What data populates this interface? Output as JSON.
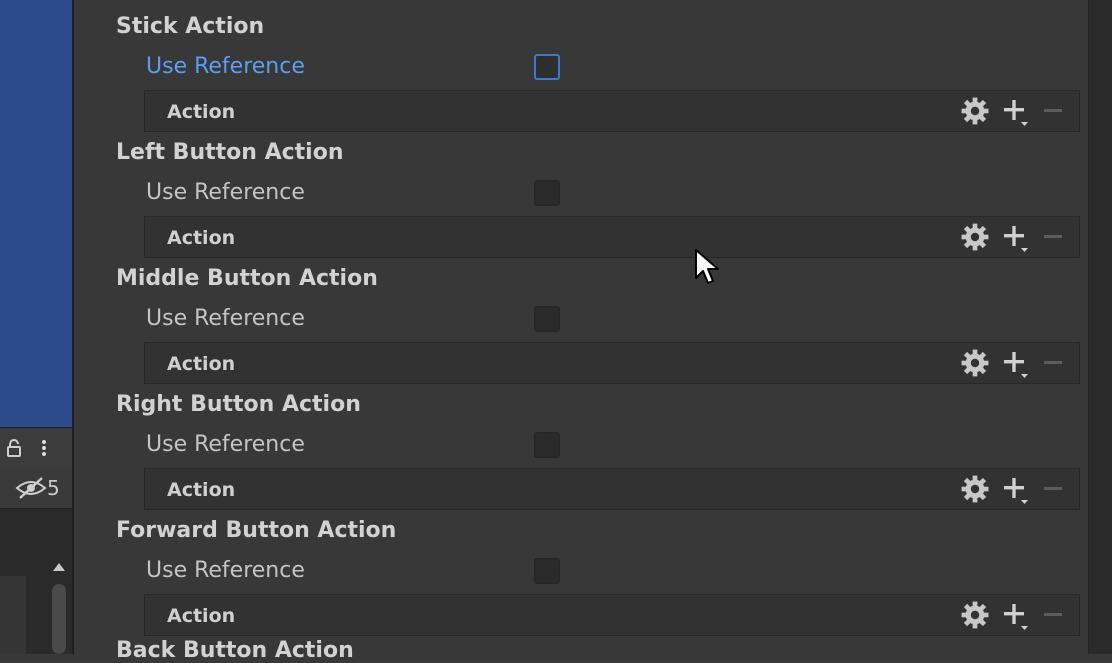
{
  "left_panel": {
    "hidden_count": "5",
    "scene_color": "#2b4b8c"
  },
  "inspector": {
    "sections": [
      {
        "title": "Stick Action",
        "use_reference_label": "Use Reference",
        "use_reference_checked": false,
        "focused": true,
        "action_label": "Action"
      },
      {
        "title": "Left Button Action",
        "use_reference_label": "Use Reference",
        "use_reference_checked": false,
        "focused": false,
        "action_label": "Action"
      },
      {
        "title": "Middle Button Action",
        "use_reference_label": "Use Reference",
        "use_reference_checked": false,
        "focused": false,
        "action_label": "Action"
      },
      {
        "title": "Right Button Action",
        "use_reference_label": "Use Reference",
        "use_reference_checked": false,
        "focused": false,
        "action_label": "Action"
      },
      {
        "title": "Forward Button Action",
        "use_reference_label": "Use Reference",
        "use_reference_checked": false,
        "focused": false,
        "action_label": "Action"
      }
    ],
    "partial_section_title": "Back Button Action"
  },
  "icons": {
    "gear": "gear-icon",
    "plus": "plus-dropdown-icon",
    "minus": "minus-icon"
  },
  "colors": {
    "accent": "#3a79d4",
    "focus_text": "#5b9ef0",
    "background": "#383838"
  }
}
